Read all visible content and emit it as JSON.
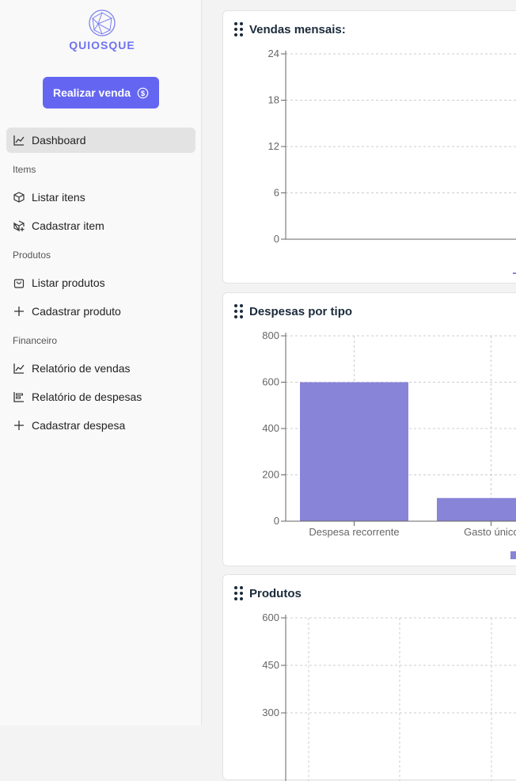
{
  "app": {
    "logo_text": "QUIOSQUE"
  },
  "sidebar": {
    "sale_button": "Realizar venda",
    "dashboard": "Dashboard",
    "sections": [
      {
        "title": "Items",
        "items": [
          "Listar itens",
          "Cadastrar item"
        ]
      },
      {
        "title": "Produtos",
        "items": [
          "Listar produtos",
          "Cadastrar produto"
        ]
      },
      {
        "title": "Financeiro",
        "items": [
          "Relatório de vendas",
          "Relatório de despesas",
          "Cadastrar despesa"
        ]
      }
    ]
  },
  "colors": {
    "accent": "#6466f1",
    "bar": "#8884d8"
  },
  "chart_data": [
    {
      "type": "line",
      "title": "Vendas mensais:",
      "ylim": [
        0,
        24
      ],
      "y_ticks": [
        0,
        6,
        12,
        18,
        24
      ],
      "series": []
    },
    {
      "type": "bar",
      "title": "Despesas por tipo",
      "categories": [
        "Despesa recorrente",
        "Gasto únicc"
      ],
      "values": [
        600,
        100
      ],
      "ylim": [
        0,
        800
      ],
      "y_ticks": [
        0,
        200,
        400,
        600,
        800
      ]
    },
    {
      "type": "bar",
      "title": "Produtos",
      "ylim": [
        0,
        600
      ],
      "y_ticks": [
        300,
        450,
        600
      ],
      "categories": [],
      "values": []
    }
  ]
}
